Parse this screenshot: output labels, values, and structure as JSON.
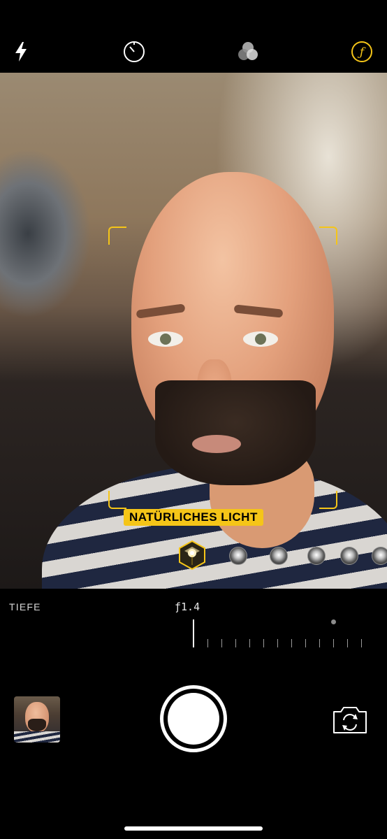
{
  "topbar": {
    "icons": [
      "flash-icon",
      "timer-icon",
      "filters-icon",
      "depth-aperture-icon"
    ],
    "accent_color": "#f5c518"
  },
  "viewfinder": {
    "lighting_label": "NATÜRLICHES LICHT",
    "lighting_options": [
      "natural-light",
      "studio-light",
      "contour-light",
      "stage-light",
      "stage-light-mono",
      "high-key-light"
    ],
    "selected_option": "natural-light"
  },
  "depth": {
    "label": "TIEFE",
    "value": "ƒ1.4"
  },
  "bottom": {
    "icons": [
      "last-photo-thumbnail",
      "shutter-button",
      "camera-flip-icon"
    ]
  }
}
